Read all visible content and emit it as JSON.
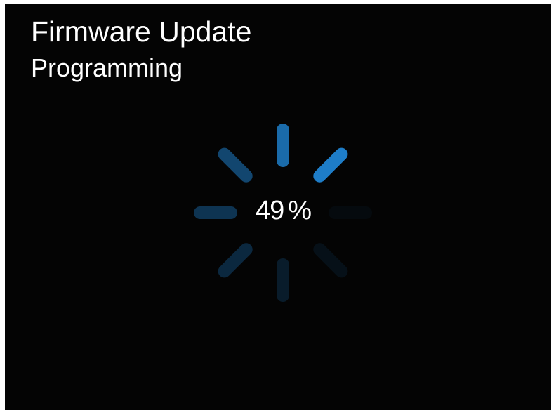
{
  "header": {
    "title": "Firmware Update",
    "subtitle": "Programming"
  },
  "progress": {
    "value": 49,
    "value_text": "49",
    "unit": "%",
    "spinner_segment_opacities": [
      1.0,
      0.85,
      0.55,
      0.4,
      0.3,
      0.2,
      0.1,
      0.05
    ]
  },
  "colors": {
    "background": "#040404",
    "text": "#ffffff",
    "accent": "#1e7dc8"
  },
  "icons": {
    "spinner": "loading-spinner-icon"
  }
}
